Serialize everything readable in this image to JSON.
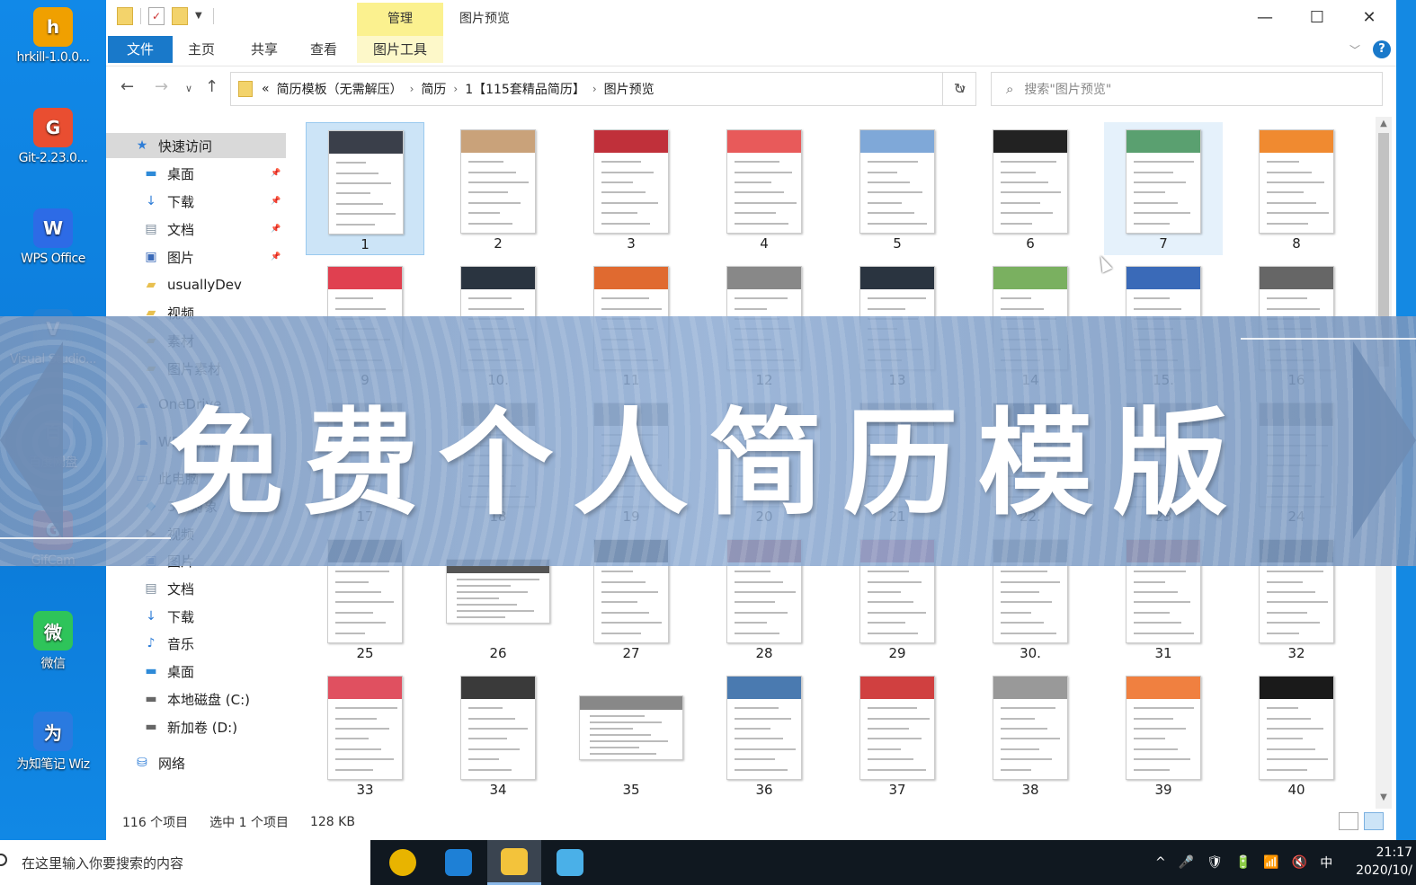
{
  "desktop": {
    "icons": [
      {
        "label": "hrkill-1.0.0...",
        "icon": "shield-icon",
        "color": "#f0a000"
      },
      {
        "label": "Git-2.23.0...",
        "icon": "git-icon",
        "color": "#e94e31"
      },
      {
        "label": "WPS Office",
        "icon": "wps-icon",
        "color": "#2d6be6"
      },
      {
        "label": "Visual Studio...",
        "icon": "vscode-icon",
        "color": "#1e80d6"
      },
      {
        "label": "百度网盘",
        "icon": "cloud-icon",
        "color": "#4a9be9"
      },
      {
        "label": "GifCam",
        "icon": "camera-icon",
        "color": "#e63a4a"
      },
      {
        "label": "微信",
        "icon": "wechat-icon",
        "color": "#2ec45a"
      },
      {
        "label": "为知笔记 Wiz",
        "icon": "wiz-icon",
        "color": "#2a7ae0"
      }
    ]
  },
  "window": {
    "title": "图片预览",
    "manage_label": "管理",
    "ribbon_tabs": [
      "文件",
      "主页",
      "共享",
      "查看",
      "图片工具"
    ],
    "controls": {
      "minimize": "—",
      "maximize": "☐",
      "close": "✕"
    },
    "help": "?"
  },
  "address": {
    "prefix": "«",
    "crumbs": [
      "简历模板（无需解压）",
      "简历",
      "1【115套精品简历】",
      "图片预览"
    ],
    "search_placeholder": "搜索\"图片预览\""
  },
  "sidebar": {
    "items": [
      {
        "label": "快速访问",
        "icon": "star-icon",
        "pinned": false,
        "indent": 30,
        "active": true
      },
      {
        "label": "桌面",
        "icon": "desktop-icon",
        "pinned": true,
        "indent": 40
      },
      {
        "label": "下载",
        "icon": "download-icon",
        "pinned": true,
        "indent": 40
      },
      {
        "label": "文档",
        "icon": "document-icon",
        "pinned": true,
        "indent": 40
      },
      {
        "label": "图片",
        "icon": "pictures-icon",
        "pinned": true,
        "indent": 40
      },
      {
        "label": "usuallyDev",
        "icon": "folder-icon",
        "pinned": false,
        "indent": 40
      },
      {
        "label": "视频",
        "icon": "folder-icon",
        "pinned": false,
        "indent": 40
      },
      {
        "label": "素材",
        "icon": "folder-icon",
        "pinned": false,
        "indent": 40
      },
      {
        "label": "图片素材",
        "icon": "folder-icon",
        "pinned": false,
        "indent": 40
      },
      {
        "label": "OneDrive",
        "icon": "cloud-icon",
        "pinned": false,
        "indent": 30
      },
      {
        "label": "WPS网盘",
        "icon": "cloud-icon",
        "pinned": false,
        "indent": 30
      },
      {
        "label": "此电脑",
        "icon": "computer-icon",
        "pinned": false,
        "indent": 30
      },
      {
        "label": "3D 对象",
        "icon": "cube-icon",
        "pinned": false,
        "indent": 40
      },
      {
        "label": "视频",
        "icon": "video-icon",
        "pinned": false,
        "indent": 40
      },
      {
        "label": "图片",
        "icon": "pictures-icon",
        "pinned": false,
        "indent": 40
      },
      {
        "label": "文档",
        "icon": "document-icon",
        "pinned": false,
        "indent": 40
      },
      {
        "label": "下载",
        "icon": "download-icon",
        "pinned": false,
        "indent": 40
      },
      {
        "label": "音乐",
        "icon": "music-icon",
        "pinned": false,
        "indent": 40
      },
      {
        "label": "桌面",
        "icon": "desktop-icon",
        "pinned": false,
        "indent": 40
      },
      {
        "label": "本地磁盘 (C:)",
        "icon": "drive-icon",
        "pinned": false,
        "indent": 40
      },
      {
        "label": "新加卷 (D:)",
        "icon": "drive-icon",
        "pinned": false,
        "indent": 40
      },
      {
        "label": "网络",
        "icon": "network-icon",
        "pinned": false,
        "indent": 30
      }
    ]
  },
  "files": {
    "numbers": [
      "1",
      "2",
      "3",
      "4",
      "5",
      "6",
      "7",
      "8",
      "9",
      "10.",
      "11",
      "12",
      "13",
      "14",
      "15.",
      "16",
      "17",
      "18",
      "19",
      "20",
      "21",
      "22.",
      "23",
      "24",
      "25",
      "26",
      "27",
      "28",
      "29",
      "30.",
      "31",
      "32",
      "33",
      "34",
      "35",
      "36",
      "37",
      "38",
      "39",
      "40"
    ],
    "accents": [
      "#3a3f4a",
      "#c9a27a",
      "#c0303a",
      "#e85a5a",
      "#7fa8d8",
      "#222222",
      "#5aa070",
      "#f08a30",
      "#e04050",
      "#2a3440",
      "#e06a30",
      "#888888",
      "#2a3440",
      "#7ab060",
      "#3a6ab8",
      "#666666",
      "#888888",
      "#888888",
      "#888888",
      "#888888",
      "#888888",
      "#2a3440",
      "#888888",
      "#888888",
      "#2a3440",
      "#555555",
      "#111111",
      "#b02020",
      "#e05070",
      "#888888",
      "#e04030",
      "#333333",
      "#e05060",
      "#3a3a3a",
      "#888888",
      "#4a7ab0",
      "#d04040",
      "#999999",
      "#f08040",
      "#1a1a1a"
    ],
    "wide": [
      26,
      35
    ],
    "selected": 1,
    "hovered": 7
  },
  "status": {
    "count": "116 个项目",
    "selected": "选中 1 个项目",
    "size": "128 KB"
  },
  "banner": {
    "title": "免费个人简历模版"
  },
  "taskbar": {
    "search_placeholder": "在这里输入你要搜索的内容",
    "apps": [
      {
        "name": "chrome-icon",
        "color": "#e8b400"
      },
      {
        "name": "vscode-icon",
        "color": "#1e80d6"
      },
      {
        "name": "file-explorer-icon",
        "color": "#f3c33b"
      },
      {
        "name": "image-viewer-icon",
        "color": "#4ab0e8"
      }
    ],
    "tray": [
      "^",
      "🎤",
      "🛡",
      "🔋",
      "📶",
      "🔇",
      "中"
    ],
    "time": "21:17",
    "date": "2020/10/"
  }
}
